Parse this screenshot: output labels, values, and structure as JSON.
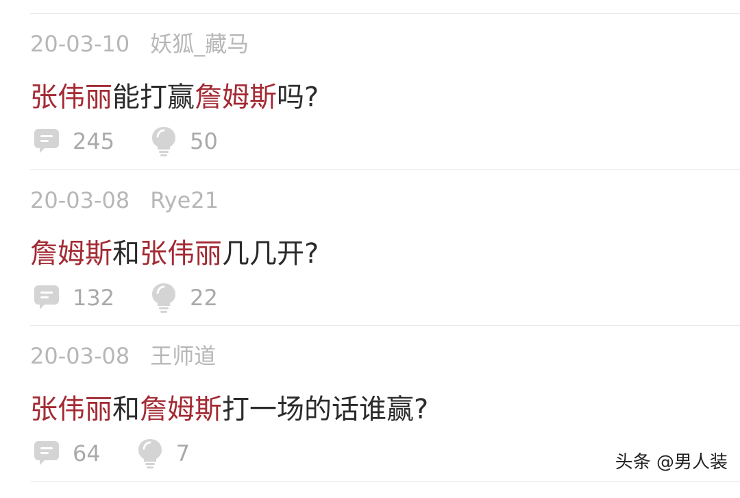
{
  "questions": [
    {
      "date": "20-03-10",
      "author": "妖狐_藏马",
      "title_parts": [
        {
          "text": "张伟丽",
          "highlight": true
        },
        {
          "text": "能打赢",
          "highlight": false
        },
        {
          "text": "詹姆斯",
          "highlight": true
        },
        {
          "text": "吗?",
          "highlight": false
        }
      ],
      "comments": "245",
      "likes": "50"
    },
    {
      "date": "20-03-08",
      "author": "Rye21",
      "title_parts": [
        {
          "text": "詹姆斯",
          "highlight": true
        },
        {
          "text": "和",
          "highlight": false
        },
        {
          "text": "张伟丽",
          "highlight": true
        },
        {
          "text": "几几开?",
          "highlight": false
        }
      ],
      "comments": "132",
      "likes": "22"
    },
    {
      "date": "20-03-08",
      "author": "王师道",
      "title_parts": [
        {
          "text": "张伟丽",
          "highlight": true
        },
        {
          "text": "和",
          "highlight": false
        },
        {
          "text": "詹姆斯",
          "highlight": true
        },
        {
          "text": "打一场的话谁赢?",
          "highlight": false
        }
      ],
      "comments": "64",
      "likes": "7"
    }
  ],
  "colors": {
    "highlight": "#a32a33",
    "title": "#2b2b2b",
    "meta": "#b7b7b7",
    "icon": "#d4d4d4"
  },
  "icons": {
    "comment": "comment-bubble-icon",
    "like": "lightbulb-icon"
  },
  "watermark": "头条 @男人装"
}
